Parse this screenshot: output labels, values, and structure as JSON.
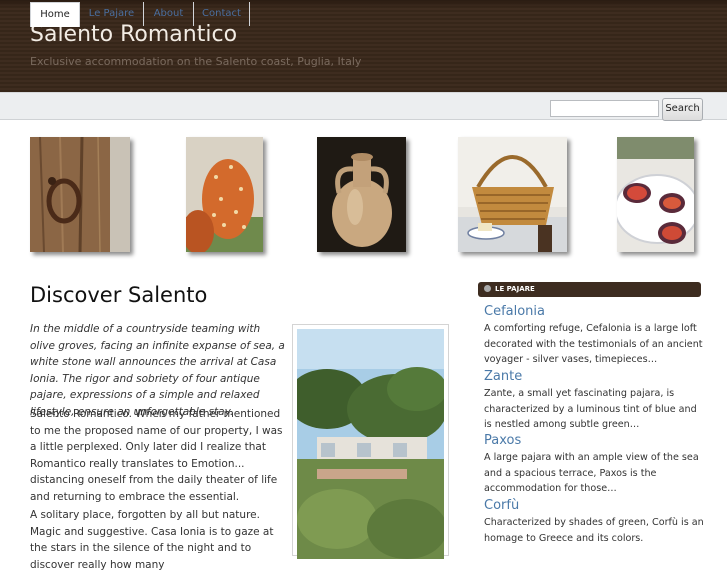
{
  "site": {
    "title": "Salento Romantico",
    "tagline": "Exclusive accommodation on the Salento coast, Puglia, Italy"
  },
  "nav": {
    "tabs": [
      {
        "label": "Home",
        "active": true
      },
      {
        "label": "Le Pajare",
        "active": false
      },
      {
        "label": "About",
        "active": false
      },
      {
        "label": "Contact",
        "active": false
      }
    ]
  },
  "search": {
    "value": "",
    "button_label": "Search"
  },
  "gallery": [
    {
      "icon": "wooden-door-ring-photo"
    },
    {
      "icon": "prickly-pear-photo"
    },
    {
      "icon": "clay-amphora-photo"
    },
    {
      "icon": "wicker-basket-photo"
    },
    {
      "icon": "figs-plate-photo"
    }
  ],
  "post": {
    "title": "Discover Salento",
    "intro": "In the middle of a countryside teaming with olive groves, facing an infinite expanse of sea, a white stone wall announces the arrival at Casa Ionia. The rigor and sobriety of four antique pajare, expressions of a simple and relaxed lifestyle, ensure an unforgettable stay.",
    "paragraph2": "Salento Romantico. When my father mentioned to me the proposed name of our property, I was a little perplexed. Only later did I realize that Romantico really translates to Emotion... distancing oneself from the daily theater of life and returning to embrace the essential.",
    "paragraph3": "A solitary place, forgotten by all but nature. Magic and suggestive. Casa Ionia is to gaze at the stars in the silence of the night and to discover really how many"
  },
  "sidebar": {
    "heading": "LE PAJARE",
    "entries": [
      {
        "title": "Cefalonia",
        "text": "A comforting refuge, Cefalonia is a large loft decorated with the testimonials of an ancient voyager - silver vases, timepieces…"
      },
      {
        "title": "Zante",
        "text": "Zante, a small yet fascinating pajara, is characterized by a luminous tint of blue and is nestled among subtle green…"
      },
      {
        "title": "Paxos",
        "text": "A large pajara with an ample view of the sea and a spacious terrace, Paxos is the accommodation for those…"
      },
      {
        "title": "Corfù",
        "text": "Characterized by shades of green, Corfù is an homage to Greece and its colors."
      }
    ]
  },
  "colors": {
    "header_bg": "#3e2c1f",
    "link": "#4a79a8",
    "sidebar_head_bg": "#3d2c20"
  }
}
